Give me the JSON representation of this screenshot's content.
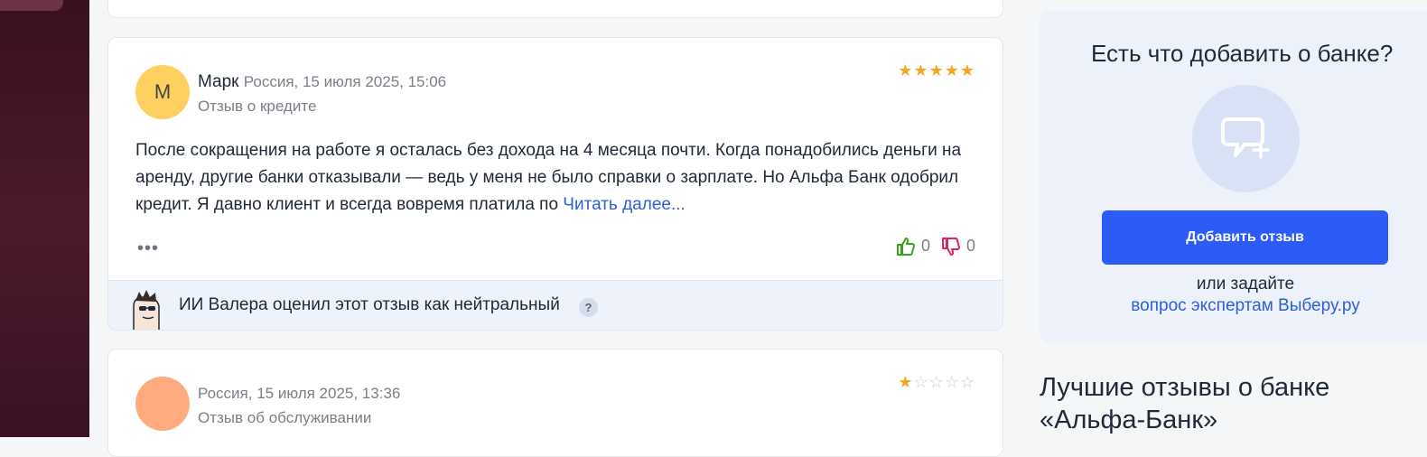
{
  "reviews": [
    {
      "avatar_letter": "М",
      "avatar_color": "#fdd060",
      "author": "Марк",
      "meta": "Россия, 15 июля 2025, 15:06",
      "kind": "Отзыв о кредите",
      "rating": 5,
      "text": "После сокращения на работе я осталась без дохода на 4 месяца почти. Когда понадобились деньги на аренду, другие банки отказывали — ведь у меня не было справки о зарплате. Но Альфа Банк одобрил кредит. Я давно клиент и всегда вовремя платила по",
      "more_label": "Читать далее...",
      "menu_label": "•••",
      "likes": "0",
      "dislikes": "0",
      "ai_note": "ИИ Валера оценил этот отзыв как нейтральный",
      "ai_help": "?"
    },
    {
      "avatar_letter": "",
      "avatar_color": "#ffab80",
      "author": "",
      "meta": "Россия, 15 июля 2025, 13:36",
      "kind": "Отзыв об обслуживании",
      "rating": 1
    }
  ],
  "sidebar": {
    "title": "Есть что добавить о банке?",
    "add_button": "Добавить отзыв",
    "or_text": "или задайте",
    "expert_link": "вопрос экспертам Выберу.ру",
    "icon": "chat-plus-icon"
  },
  "best_reviews_title": "Лучшие отзывы о банке «Альфа-Банк»",
  "colors": {
    "star": "#f5a623",
    "link": "#2c5fd8",
    "primary_button": "#2b5cf6",
    "like": "#3aa31d",
    "dislike": "#e0245e"
  }
}
